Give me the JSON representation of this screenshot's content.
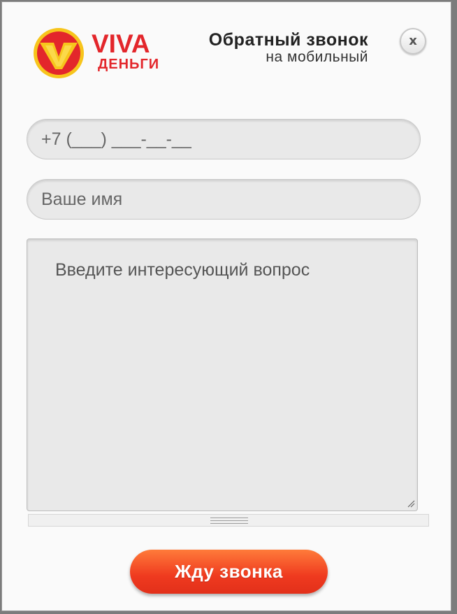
{
  "brand": {
    "name_line1": "VIVA",
    "name_line2": "ДЕНЬГИ",
    "logo_icon": "viva-v-logo-icon"
  },
  "header": {
    "title": "Обратный звонок",
    "subtitle": "на мобильный",
    "close_label": "x"
  },
  "form": {
    "phone_value": "+7 (___) ___-__-__",
    "name_placeholder": "Ваше имя",
    "question_placeholder": "Введите интересующий вопрос",
    "submit_label": "Жду звонка"
  },
  "colors": {
    "brand_red": "#e3262b",
    "logo_yellow": "#f7c51c",
    "button_orange": "#ef3a1f"
  }
}
